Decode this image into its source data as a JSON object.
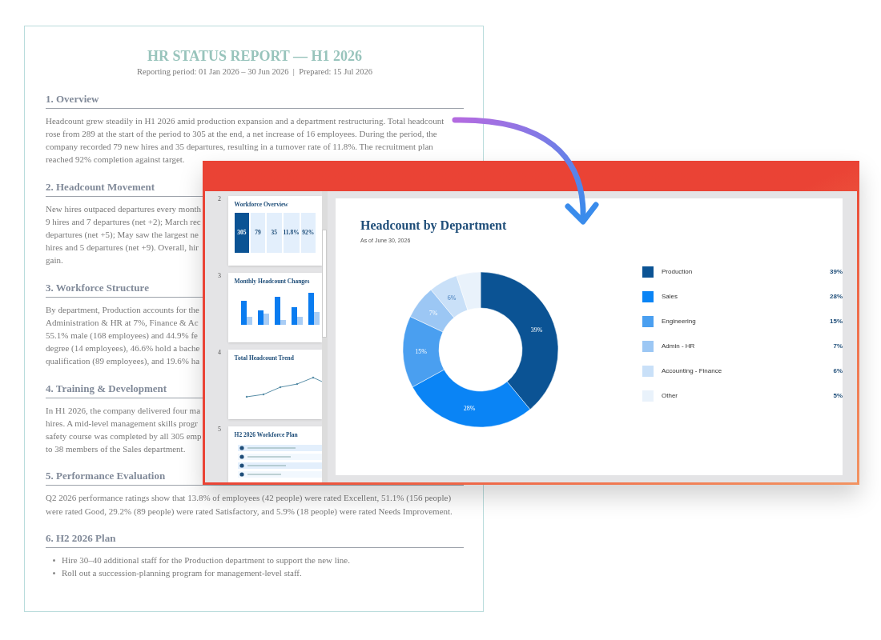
{
  "document": {
    "title": "HR STATUS REPORT — H1 2026",
    "meta": "Reporting period: 01 Jan 2026 – 30 Jun 2026  |  Prepared: 15 Jul 2026",
    "sections": [
      {
        "heading": "1. Overview",
        "kind": "paragraph",
        "lines": [
          "Headcount grew steadily in H1 2026 amid production expansion and a department restructuring. Total headcount",
          "rose from 289 at the start of the period to 305 at the end, a net increase of 16 employees. During the period, the",
          "company recorded 79 new hires and 35 departures, resulting in a turnover rate of 11.8%. The recruitment plan",
          "reached 92% completion against target."
        ]
      },
      {
        "heading": "2. Headcount Movement",
        "kind": "paragraph",
        "lines": [
          "New hires outpaced departures every month",
          "9 hires and 7 departures (net +2); March rec",
          "departures (net +5); May saw the largest ne",
          "hires and 5 departures (net +9). Overall, hir",
          "gain."
        ]
      },
      {
        "heading": "3. Workforce Structure",
        "kind": "paragraph",
        "lines": [
          "By department, Production accounts for the",
          "Administration & HR at 7%, Finance & Ac",
          "55.1% male (168 employees) and 44.9% fe",
          "degree (14 employees), 46.6% hold a bache",
          "qualification (89 employees), and 19.6% ha"
        ]
      },
      {
        "heading": "4. Training & Development",
        "kind": "paragraph",
        "lines": [
          "In H1 2026, the company delivered four ma",
          "hires. A mid-level management skills progr",
          "safety course was completed by all 305 emp",
          "to 38 members of the Sales department."
        ]
      },
      {
        "heading": "5. Performance Evaluation",
        "kind": "paragraph",
        "lines": [
          "Q2 2026 performance ratings show that 13.8% of employees (42 people) were rated Excellent, 51.1% (156 people)",
          "were rated Good, 29.2% (89 people) were rated Satisfactory, and 5.9% (18 people) were rated Needs Improvement."
        ]
      },
      {
        "heading": "6. H2 2026 Plan",
        "kind": "bullets",
        "lines": [
          "Hire 30–40 additional staff for the Production department to support the new line.",
          "Roll out a succession-planning program for management-level staff."
        ]
      }
    ]
  },
  "presentation": {
    "thumbnails": [
      {
        "number": "2",
        "kind": "kpi",
        "title": "Workforce Overview",
        "kpis": [
          "305",
          "79",
          "35",
          "11.8%",
          "92%"
        ]
      },
      {
        "number": "3",
        "kind": "bars",
        "title": "Monthly Headcount Changes"
      },
      {
        "number": "4",
        "kind": "line",
        "title": "Total Headcount Trend"
      },
      {
        "number": "5",
        "kind": "plan",
        "title": "H2 2026 Workforce Plan"
      }
    ],
    "slide": {
      "title": "Headcount by Department",
      "subtitle": "As of June 30, 2026",
      "legend": [
        {
          "value": "39%",
          "color": "#0b5394"
        },
        {
          "value": "28%",
          "color": "#0a84f5"
        },
        {
          "value": "15%",
          "color": "#4a9ff0"
        },
        {
          "value": "7%",
          "color": "#9cc7f4"
        },
        {
          "value": "6%",
          "color": "#c9e0f8"
        },
        {
          "value": "5%",
          "color": "#e9f2fb"
        }
      ],
      "chart_data": {
        "type": "donut",
        "categories": [
          "Production",
          "Sales",
          "Engineering",
          "Admin - HR",
          "Accounting - Finance",
          "Other"
        ],
        "series": [
          {
            "values": [
              39,
              28,
              15,
              7,
              6,
              5
            ]
          }
        ],
        "value_labels": [
          "39%",
          "28%",
          "15%",
          "7%",
          "6%",
          null
        ]
      }
    }
  }
}
